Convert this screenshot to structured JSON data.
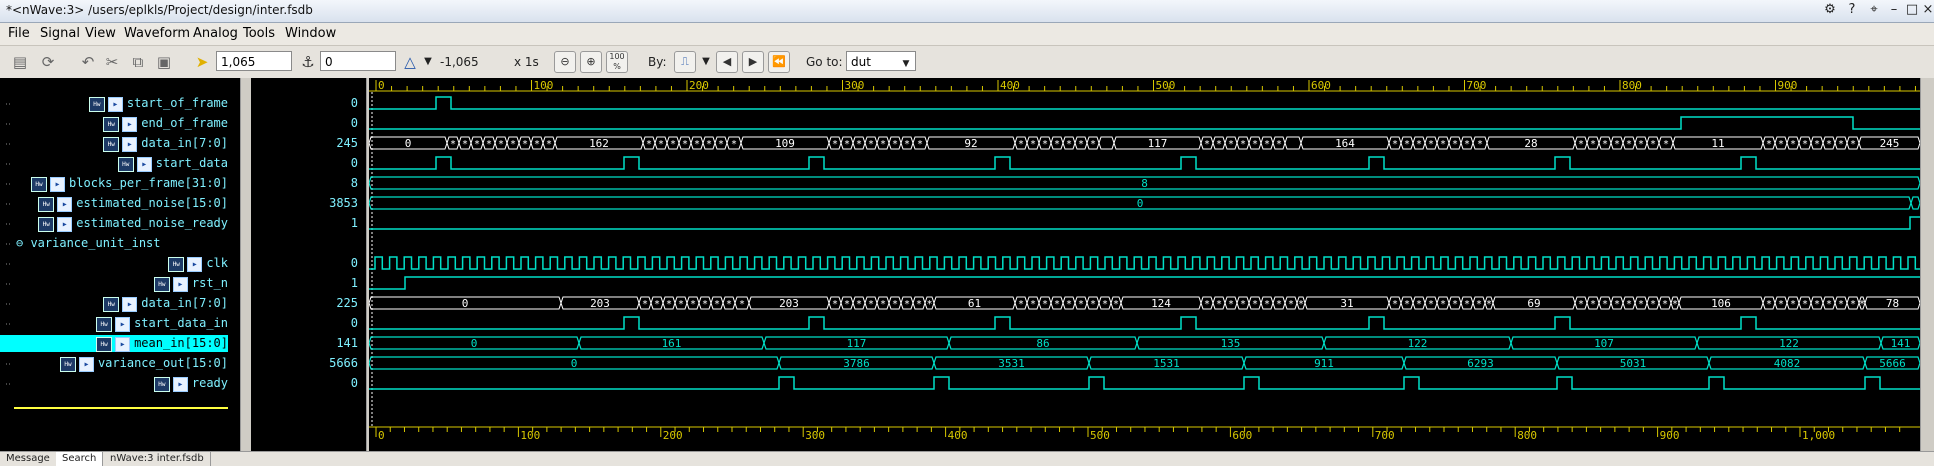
{
  "window": {
    "title": "*<nWave:3> /users/eplkls/Project/design/inter.fsdb"
  },
  "menu": [
    "File",
    "Signal",
    "View",
    "Waveform",
    "Analog",
    "Tools",
    "Window"
  ],
  "toolbar": {
    "cursor_time": "1,065",
    "marker_time": "0",
    "delta": "-1,065",
    "scale": "x 1s",
    "by_label": "By:",
    "goto_label": "Go to:",
    "goto_value": "dut"
  },
  "signals": [
    {
      "name": "start_of_frame",
      "value": "0",
      "indent": 2
    },
    {
      "name": "end_of_frame",
      "value": "0",
      "indent": 2
    },
    {
      "name": "data_in[7:0]",
      "value": "245",
      "indent": 2
    },
    {
      "name": "start_data",
      "value": "0",
      "indent": 2
    },
    {
      "name": "blocks_per_frame[31:0]",
      "value": "8",
      "indent": 1
    },
    {
      "name": "estimated_noise[15:0]",
      "value": "3853",
      "indent": 1
    },
    {
      "name": "estimated_noise_ready",
      "value": "1",
      "indent": 1
    },
    {
      "name": "variance_unit_inst",
      "value": "",
      "indent": 0
    },
    {
      "name": "clk",
      "value": "0",
      "indent": 3
    },
    {
      "name": "rst_n",
      "value": "1",
      "indent": 3
    },
    {
      "name": "data_in[7:0]",
      "value": "225",
      "indent": 2
    },
    {
      "name": "start_data_in",
      "value": "0",
      "indent": 2
    },
    {
      "name": "mean_in[15:0]",
      "value": "141",
      "indent": 2
    },
    {
      "name": "variance_out[15:0]",
      "value": "5666",
      "indent": 1
    },
    {
      "name": "ready",
      "value": "0",
      "indent": 3
    }
  ],
  "ruler_top": [
    "0",
    "100",
    "200",
    "300",
    "400",
    "500",
    "600",
    "700",
    "800",
    "900"
  ],
  "ruler_bottom": [
    "0",
    "100",
    "200",
    "300",
    "400",
    "500",
    "600",
    "700",
    "800",
    "900",
    "1,000"
  ],
  "bus_labels": {
    "data_in_a": [
      "0",
      "162",
      "109",
      "92",
      "117",
      "164",
      "28",
      "11",
      "245"
    ],
    "blocks": "8",
    "noise": "0",
    "data_in_b": [
      "0",
      "203",
      "203",
      "61",
      "124",
      "31",
      "69",
      "106",
      "78"
    ],
    "mean_in": [
      "0",
      "161",
      "117",
      "86",
      "135",
      "122",
      "107",
      "122",
      "141"
    ],
    "variance_out": [
      "0",
      "3786",
      "3531",
      "1531",
      "911",
      "6293",
      "5031",
      "4082",
      "5666"
    ]
  },
  "status_tabs": [
    "Message",
    "Search",
    "nWave:3 inter.fsdb"
  ],
  "colors": {
    "wave": "#00e0c8",
    "signal_text": "#7ff0ff",
    "ruler": "#d8c800",
    "selected": "#00ffff"
  }
}
